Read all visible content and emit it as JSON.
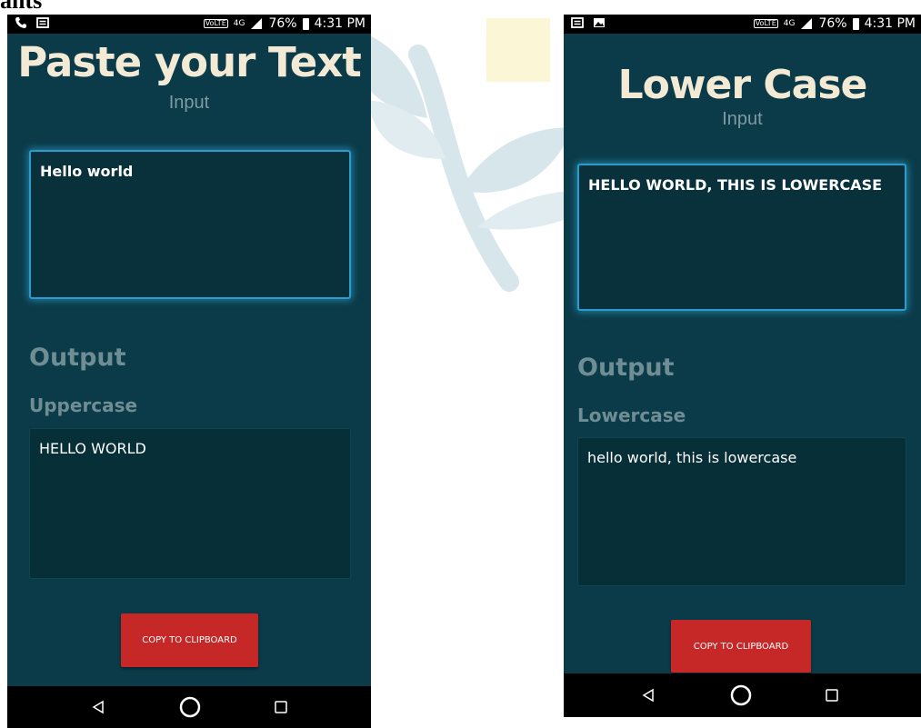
{
  "corner_text": "ants",
  "colors": {
    "screen_bg": "#0b3b48",
    "title": "#f3ead6",
    "muted_text": "#6f8d95",
    "input_border": "#2c9bd0",
    "button": "#c62828"
  },
  "screens": {
    "left": {
      "status": {
        "battery": "76%",
        "time": "4:31 PM",
        "network": "4G",
        "left_icons": [
          "phone-icon",
          "message-icon"
        ]
      },
      "title": "Paste your Text",
      "subtitle": "Input",
      "input_value": "Hello world",
      "output_heading": "Output",
      "output_mode": "Uppercase",
      "output_value": "HELLO WORLD",
      "button_label": "COPY TO CLIPBOARD"
    },
    "right": {
      "status": {
        "battery": "76%",
        "time": "4:31 PM",
        "network": "4G",
        "left_icons": [
          "message-icon",
          "image-icon"
        ]
      },
      "title": "Lower Case",
      "subtitle": "Input",
      "input_value": "HELLO WORLD, THIS IS LOWERCASE",
      "output_heading": "Output",
      "output_mode": "Lowercase",
      "output_value": "hello world, this is lowercase",
      "button_label": "COPY TO CLIPBOARD"
    }
  }
}
